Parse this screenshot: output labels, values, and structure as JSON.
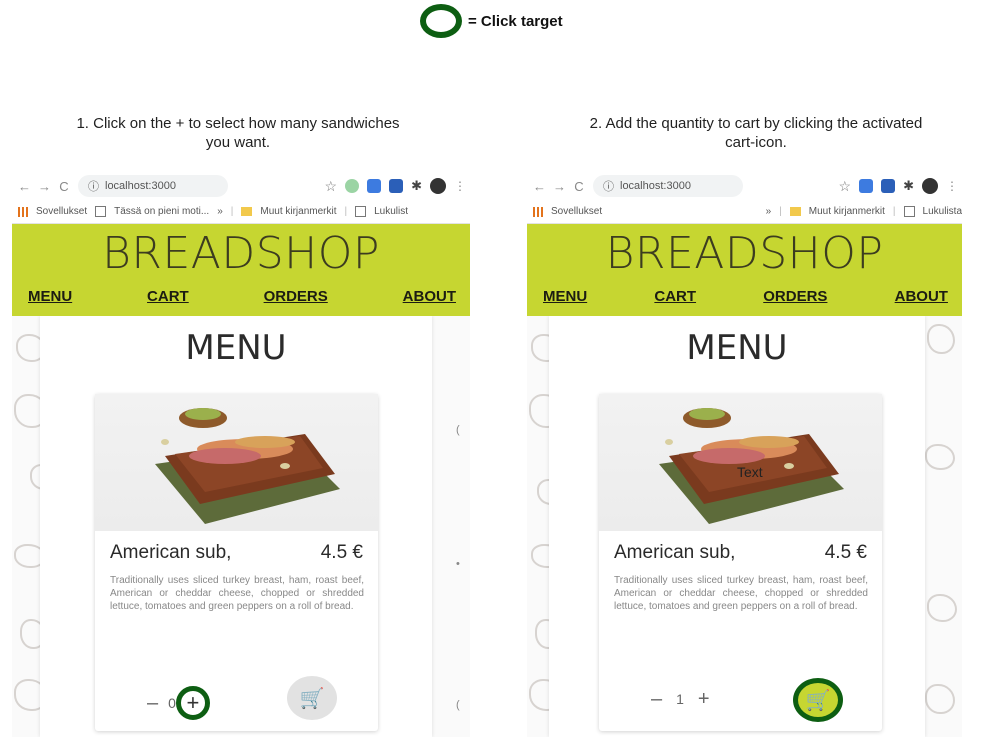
{
  "legend": {
    "text": "= Click target"
  },
  "steps": [
    {
      "text": "1. Click on the + to select how many sandwiches you want."
    },
    {
      "text": "2. Add the quantity to cart by clicking the activated cart-icon."
    }
  ],
  "browser": {
    "url": "localhost:3000",
    "nav_back": "←",
    "nav_forward": "→",
    "nav_reload": "C",
    "info_icon": "ⓘ",
    "star": "☆",
    "puzzle": "✱",
    "kebab": "⋮",
    "left_bookmarks": {
      "apps": "Sovellukset",
      "page": "Tässä on pieni moti...",
      "chevrons": "»",
      "sep": "|",
      "other": "Muut kirjanmerkit",
      "reading": "Lukulist"
    },
    "right_bookmarks": {
      "apps": "Sovellukset",
      "chevrons": "»",
      "sep": "|",
      "other": "Muut kirjanmerkit",
      "reading": "Lukulista"
    }
  },
  "app": {
    "brand": "BREADSHOP",
    "nav": [
      "MENU",
      "CART",
      "ORDERS",
      "ABOUT"
    ],
    "page_title": "MENU",
    "item": {
      "name": "American sub,",
      "price": "4.5 €",
      "description": "Traditionally uses sliced turkey breast, ham, roast beef, American or cheddar cheese, chopped or shredded lettuce, tomatoes and green peppers on a roll of bread."
    },
    "left_state": {
      "minus": "–",
      "quantity": "0",
      "plus": "+"
    },
    "right_state": {
      "minus": "–",
      "quantity": "1",
      "plus": "+",
      "photo_overlay_text": "Text"
    },
    "cart_icon": "🛒",
    "edge_marks": [
      "(",
      "•",
      "("
    ]
  },
  "colors": {
    "brand_green": "#c6d631",
    "click_target": "#0d5e12"
  }
}
